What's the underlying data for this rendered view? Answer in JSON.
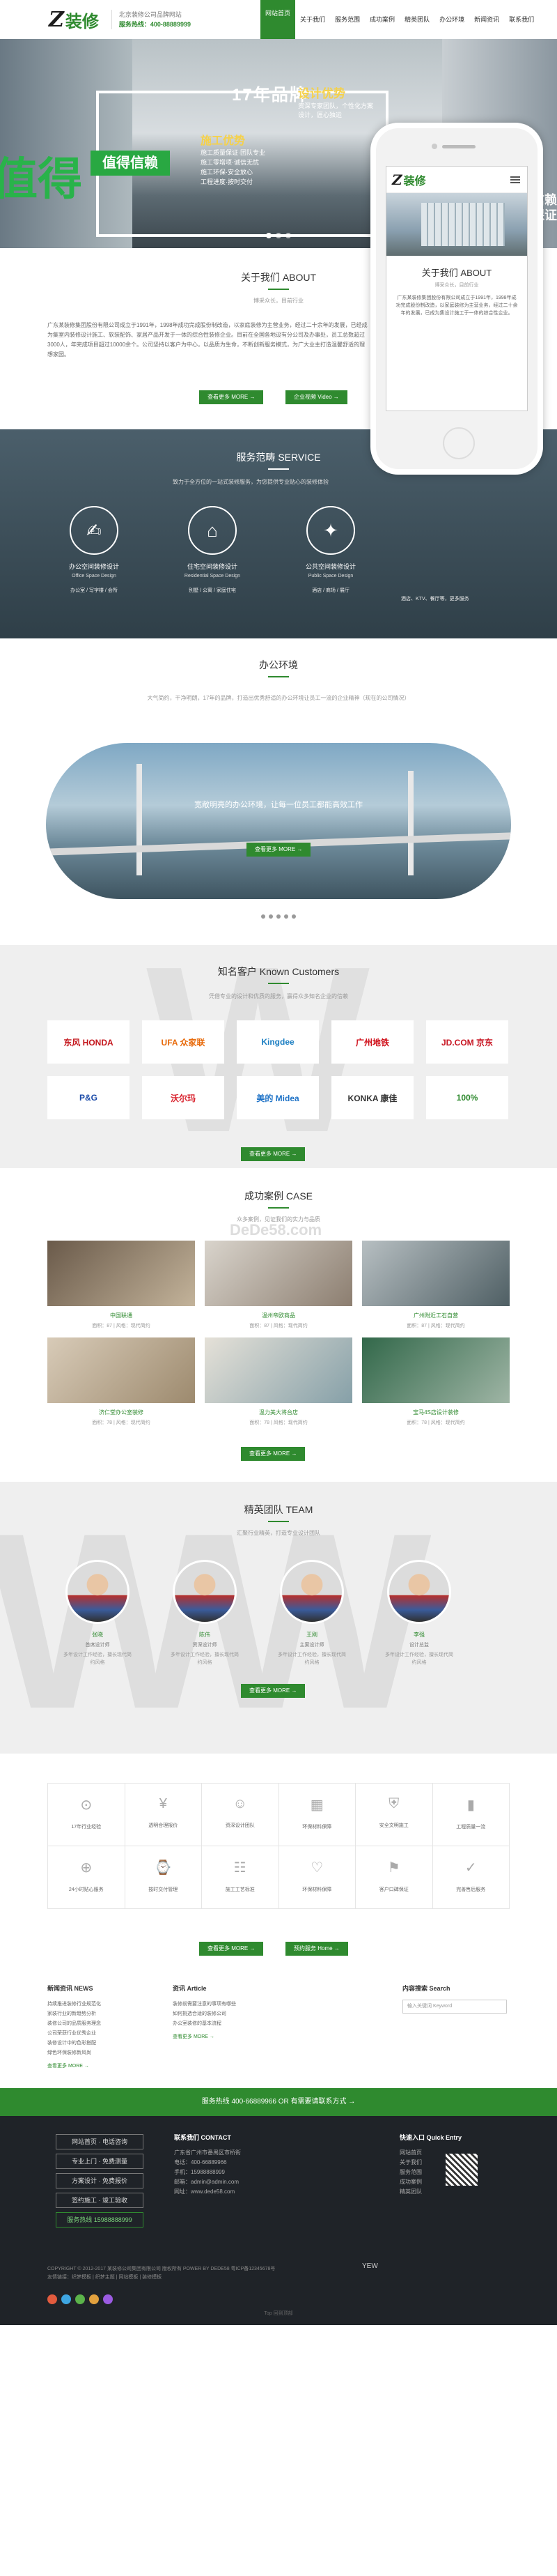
{
  "header": {
    "logo_z": "Z",
    "logo_text": "装修",
    "slogan_line1": "北京装修公司品牌网站",
    "slogan_line2": "服务热线：400-88889999",
    "nav": [
      "网站首页",
      "关于我们",
      "服务范围",
      "成功案例",
      "精英团队",
      "办公环境",
      "新闻资讯",
      "联系我们"
    ]
  },
  "banner": {
    "title": "17年品牌",
    "green_tag": "值得信赖",
    "big_left": "值得",
    "right_text_1": "1特色信赖",
    "right_text_2": "1导，保证",
    "service_title": "施工优势",
    "service_list": [
      "施工质量保证·团队专业",
      "施工零增项·诚信无忧",
      "施工环保·安全放心",
      "工程进度·按时交付"
    ],
    "adv_title": "设计优势",
    "adv_text": "资深专家团队，个性化方案设计，匠心独运"
  },
  "about": {
    "title": "关于我们 ABOUT",
    "sub": "博采众长，目前行业",
    "text": "广东某装修集团股份有限公司成立于1991年，1998年成功完成股份制改造，以家庭装修为主营业务，经过二十余年的发展，已经成为集室内装修设计施工、软装配饰、家居产品开发于一体的综合性装修企业。目前在全国各地设有分公司及办事处，员工总数超过3000人，年完成项目超过10000余个。公司坚持以客户为中心，以品质为生命，不断创新服务模式，为广大业主打造温馨舒适的理想家园。",
    "btn1": "查看更多 MORE →",
    "btn2": "企业视频 Video →"
  },
  "phone": {
    "title": "关于我们 ABOUT",
    "sub": "博采众长，目前行业",
    "text": "广东某装修集团股份有限公司成立于1991年，1998年成功完成股份制改造，以家庭装修为主营业务，经过二十余年的发展，已成为集设计施工于一体的综合性企业。"
  },
  "service": {
    "title": "服务范畴 SERVICE",
    "sub": "致力于全方位的一站式装修服务，为您提供专业贴心的装修体验",
    "items": [
      {
        "icon": "✍",
        "t": "办公空间装修设计",
        "e": "Office Space Design",
        "d": "办公室 / 写字楼 / 会所"
      },
      {
        "icon": "⌂",
        "t": "住宅空间装修设计",
        "e": "Residential Space Design",
        "d": "别墅 / 公寓 / 家庭住宅"
      },
      {
        "icon": "✦",
        "t": "公共空间装修设计",
        "e": "Public Space Design",
        "d": "酒店 / 商场 / 展厅"
      }
    ],
    "right_text": "酒店、KTV、餐厅等，更多服务"
  },
  "office": {
    "title": "办公环境",
    "sub": "大气简约，干净明朗，17年的品牌，打造出优秀舒适的办公环境让员工一流的企业精神（现在的公司情况）",
    "caption": "宽敞明亮的办公环境，让每一位员工都能高效工作",
    "btn": "查看更多 MORE →"
  },
  "clients": {
    "title": "知名客户 Known Customers",
    "sub": "凭借专业的设计和优质的服务，赢得众多知名企业的信赖",
    "logos": [
      "东风 HONDA",
      "UFA 众家联",
      "Kingdee",
      "广州地铁",
      "JD.COM 京东",
      "P&G",
      "沃尔玛",
      "美的 Midea",
      "KONKA 康佳",
      "100%"
    ],
    "btn": "查看更多 MORE →"
  },
  "cases": {
    "title": "成功案例 CASE",
    "sub": "众多案例，见证我们的实力与品质",
    "watermark": "DeDe58.com",
    "items": [
      {
        "t": "中国联通",
        "m": "面积：87 | 风格：现代简约"
      },
      {
        "t": "温州帝欧商品",
        "m": "面积：87 | 风格：现代简约"
      },
      {
        "t": "广州附近工石自营",
        "m": "面积：87 | 风格：现代简约"
      },
      {
        "t": "济仁堂办公室装修",
        "m": "面积：78 | 风格：现代简约"
      },
      {
        "t": "温力美大将台店",
        "m": "面积：78 | 风格：现代简约"
      },
      {
        "t": "宝马4S店设计装修",
        "m": "面积：78 | 风格：现代简约"
      }
    ],
    "btn": "查看更多 MORE →"
  },
  "team": {
    "title": "精英团队 TEAM",
    "sub": "汇聚行业精英，打造专业设计团队",
    "members": [
      {
        "n": "张晓",
        "r": "首席设计师",
        "d": "多年设计工作经验，擅长现代简约风格"
      },
      {
        "n": "陈伟",
        "r": "资深设计师",
        "d": "多年设计工作经验，擅长现代简约风格"
      },
      {
        "n": "王刚",
        "r": "主案设计师",
        "d": "多年设计工作经验，擅长现代简约风格"
      },
      {
        "n": "李强",
        "r": "设计总监",
        "d": "多年设计工作经验，擅长现代简约风格"
      }
    ],
    "btn": "查看更多 MORE →"
  },
  "features": {
    "items": [
      {
        "ic": "⊙",
        "t": "17年行业经验"
      },
      {
        "ic": "¥",
        "t": "透明合理报价"
      },
      {
        "ic": "☺",
        "t": "资深设计团队"
      },
      {
        "ic": "▦",
        "t": "环保材料保障"
      },
      {
        "ic": "⛨",
        "t": "安全文明施工"
      },
      {
        "ic": "▮",
        "t": "工程质量一流"
      },
      {
        "ic": "⊕",
        "t": "24小时贴心服务"
      },
      {
        "ic": "⌚",
        "t": "按时交付管理"
      },
      {
        "ic": "☷",
        "t": "施工工艺标准"
      },
      {
        "ic": "♡",
        "t": "环保材料保障"
      },
      {
        "ic": "⚑",
        "t": "客户口碑保证"
      },
      {
        "ic": "✓",
        "t": "完善售后服务"
      }
    ],
    "btn1": "查看更多 MORE →",
    "btn2": "预约服务 Home →"
  },
  "news": {
    "col1_title": "新闻资讯 NEWS",
    "col1_items": [
      "持续推进装修行业规范化",
      "家装行业的新趋势分析",
      "装修公司的品质服务理念",
      "公司荣获行业优秀企业",
      "装修设计中的色彩搭配",
      "绿色环保装修新风尚"
    ],
    "col1_more": "查看更多 MORE →",
    "col2_title": "资讯 Article",
    "col2_items": [
      "装修前需要注意的事项有哪些",
      "如何挑选合适的装修公司",
      "办公室装修的基本流程"
    ],
    "col2_more": "查看更多 MORE →",
    "col3_title": "内容搜索 Search",
    "search_placeholder": "输入关键词 Keyword"
  },
  "hotbar": {
    "text": "服务热线 400-66889966 OR 有需要请联系方式 →"
  },
  "footer": {
    "menu": [
      "网站首页 · 电话咨询",
      "专业上门 · 免费测量",
      "方案设计 · 免费报价",
      "签约施工 · 竣工验收",
      "服务热线 15988888999"
    ],
    "contact_title": "联系我们 CONTACT",
    "contact_lines": [
      "广东省广州市番禺区市桥街",
      "电话：400-66889966",
      "手机：15988888999",
      "邮箱：admin@admin.com",
      "网址：www.dede58.com"
    ],
    "quick_title": "快速入口 Quick Entry",
    "quick_items": [
      "网站首页",
      "关于我们",
      "服务范围",
      "成功案例",
      "精英团队"
    ],
    "copy1": "COPYRIGHT © 2012-2017 某装修公司集团有限公司 版权所有 POWER BY DEDE58 粤ICP备12345678号",
    "copy2": "友情链接：织梦模板 | 织梦主题 | 网站模板 | 装修模板",
    "brand": "YEW",
    "bottom": "Top 回到顶部"
  }
}
